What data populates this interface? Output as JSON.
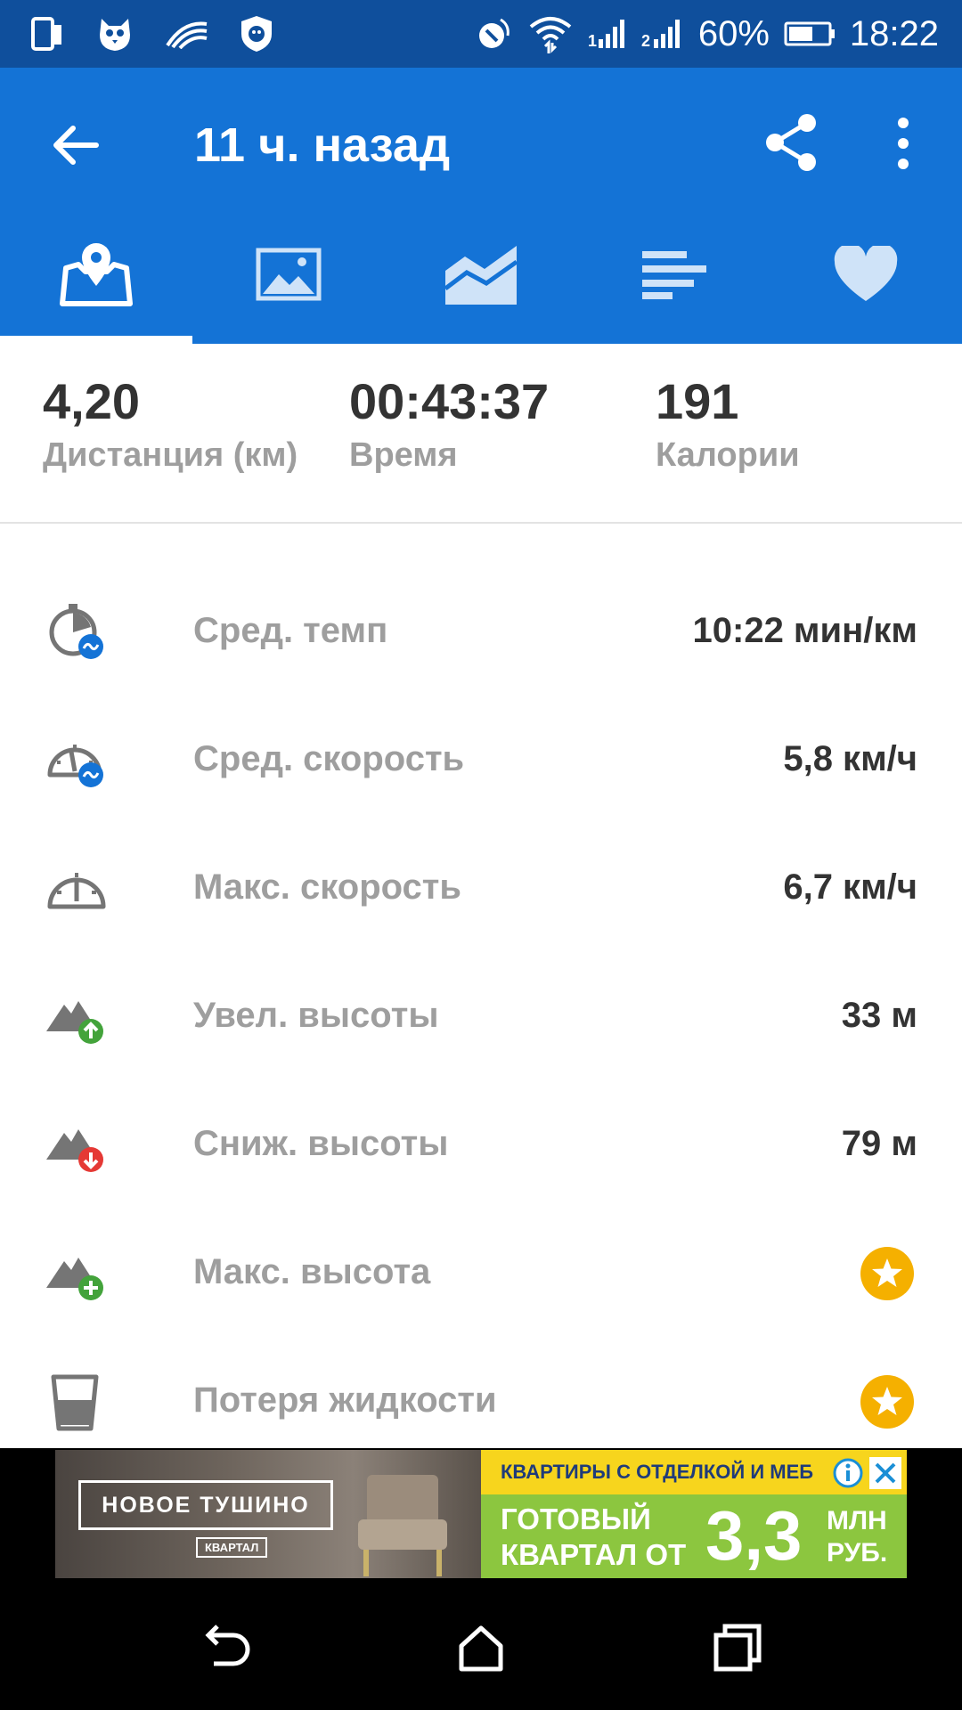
{
  "status_bar": {
    "battery": "60%",
    "time": "18:22",
    "icons": [
      "tablet-icon",
      "bird-icon",
      "swipe-keyboard-icon",
      "shield-icon",
      "nfc-icon",
      "wifi-icon",
      "signal-sim1-icon",
      "signal-sim2-icon",
      "battery-icon"
    ]
  },
  "app_bar": {
    "title": "11 ч. назад",
    "tabs": [
      "map-tab",
      "photos-tab",
      "charts-tab",
      "splits-tab",
      "heart-rate-tab"
    ],
    "accent_color": "#1473d6"
  },
  "summary": {
    "distance_value": "4,20",
    "distance_label": "Дистанция (км)",
    "time_value": "00:43:37",
    "time_label": "Время",
    "calories_value": "191",
    "calories_label": "Калории"
  },
  "stats": {
    "avg_pace": {
      "label": "Сред. темп",
      "value": "10:22 мин/км"
    },
    "avg_speed": {
      "label": "Сред. скорость",
      "value": "5,8 км/ч"
    },
    "max_speed": {
      "label": "Макс. скорость",
      "value": "6,7 км/ч"
    },
    "elevation_gain": {
      "label": "Увел. высоты",
      "value": "33 м"
    },
    "elevation_loss": {
      "label": "Сниж. высоты",
      "value": "79 м"
    },
    "max_elevation": {
      "label": "Макс. высота",
      "value": ""
    },
    "fluid_loss": {
      "label": "Потеря жидкости",
      "value": ""
    }
  },
  "ad": {
    "brand": "НОВОЕ ТУШИНО",
    "brand_sub": "КВАРТАЛ",
    "top_line": "КВАРТИРЫ С ОТДЕЛКОЙ И МЕБ",
    "headline_line1": "ГОТОВЫЙ",
    "headline_line2": "КВАРТАЛ ОТ",
    "price": "3,3",
    "unit_line1": "МЛН",
    "unit_line2": "РУБ."
  }
}
